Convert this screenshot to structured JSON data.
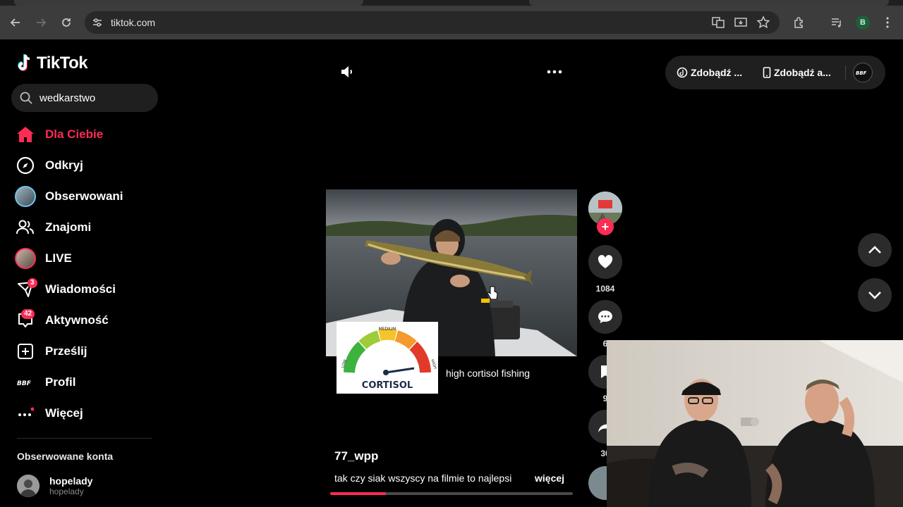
{
  "browser": {
    "url": "tiktok.com",
    "profile_initial": "B"
  },
  "app": {
    "name": "TikTok",
    "brand_color": "#fe2c55"
  },
  "search": {
    "value": "wedkarstwo"
  },
  "nav": {
    "items": [
      {
        "label": "Dla Ciebie",
        "icon": "home-icon",
        "active": true
      },
      {
        "label": "Odkryj",
        "icon": "compass-icon"
      },
      {
        "label": "Obserwowani",
        "icon": "avatar"
      },
      {
        "label": "Znajomi",
        "icon": "friends-icon"
      },
      {
        "label": "LIVE",
        "icon": "live-avatar"
      },
      {
        "label": "Wiadomości",
        "icon": "messages-icon",
        "badge": "3"
      },
      {
        "label": "Aktywność",
        "icon": "activity-icon",
        "badge": "42"
      },
      {
        "label": "Prześlij",
        "icon": "upload-icon"
      },
      {
        "label": "Profil",
        "icon": "profile-logo"
      },
      {
        "label": "Więcej",
        "icon": "more-icon"
      }
    ]
  },
  "followed": {
    "title": "Obserwowane konta",
    "accounts": [
      {
        "name": "hopelady",
        "handle": "hopelady"
      }
    ]
  },
  "top_pill": {
    "btn1": "Zdobądź ...",
    "btn2": "Zdobądź a..."
  },
  "video": {
    "overlay_caption": "high cortisol fishing",
    "gauge_label": "CORTISOL",
    "gauge_top": "MEDIUM",
    "gauge_left": "LOW",
    "gauge_right": "HIGH",
    "author": "77_wpp",
    "description": "tak czy siak wszyscy na filmie to najlepsi",
    "more_label": "więcej",
    "progress": 0.23
  },
  "actions": {
    "likes": "1084",
    "comments": "6",
    "saves": "9",
    "shares": "30"
  }
}
